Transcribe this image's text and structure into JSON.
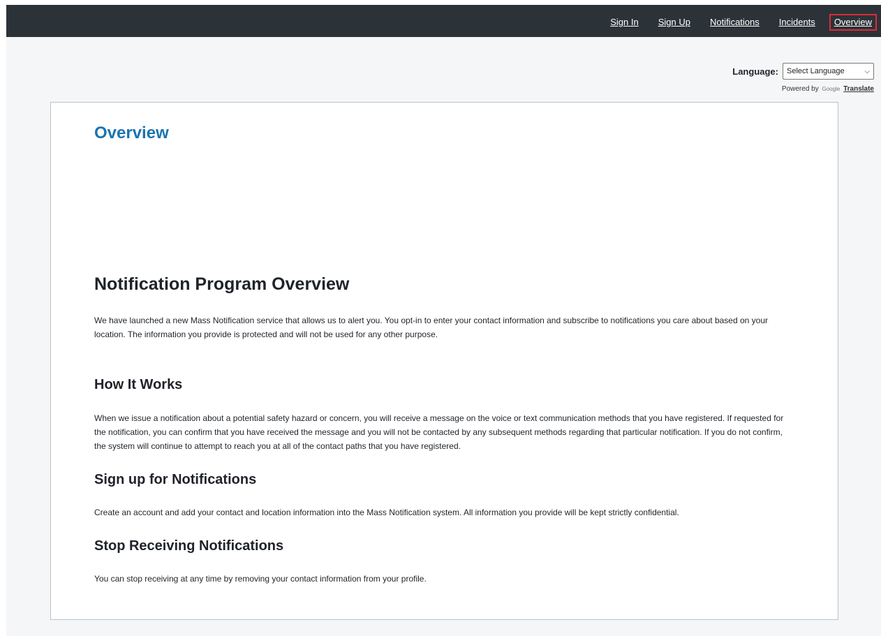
{
  "nav": {
    "sign_in": "Sign In",
    "sign_up": "Sign Up",
    "notifications": "Notifications",
    "incidents": "Incidents",
    "overview": "Overview"
  },
  "language": {
    "label": "Language:",
    "selected": "Select Language",
    "powered_by": "Powered by",
    "google": "Google",
    "translate": "Translate"
  },
  "page": {
    "title": "Overview",
    "section1_heading": "Notification Program Overview",
    "section1_text": "We have launched a new Mass Notification service that allows us to alert you. You opt-in to enter your contact information and subscribe to notifications you care about based on your location. The information you provide is protected and will not be used for any other purpose.",
    "section2_heading": "How It Works",
    "section2_text": "When we issue a notification about a potential safety hazard or concern, you will receive a message on the voice or text communication methods that you have registered. If requested for the notification, you can confirm that you have received the message and you will not be contacted by any subsequent methods regarding that  particular notification. If you do not confirm, the system will continue to attempt to reach you at all of the contact paths that you have registered.",
    "section3_heading": "Sign up for Notifications",
    "section3_text": "Create an account and add your contact and location information into the Mass Notification system. All information you provide will be kept strictly confidential.",
    "section4_heading": "Stop Receiving Notifications",
    "section4_text": "You can stop receiving at any time by removing your contact information from your profile."
  },
  "colors": {
    "topbar": "#2b3338",
    "accent_title": "#1b74b0",
    "active_nav_border": "#e0293a"
  }
}
